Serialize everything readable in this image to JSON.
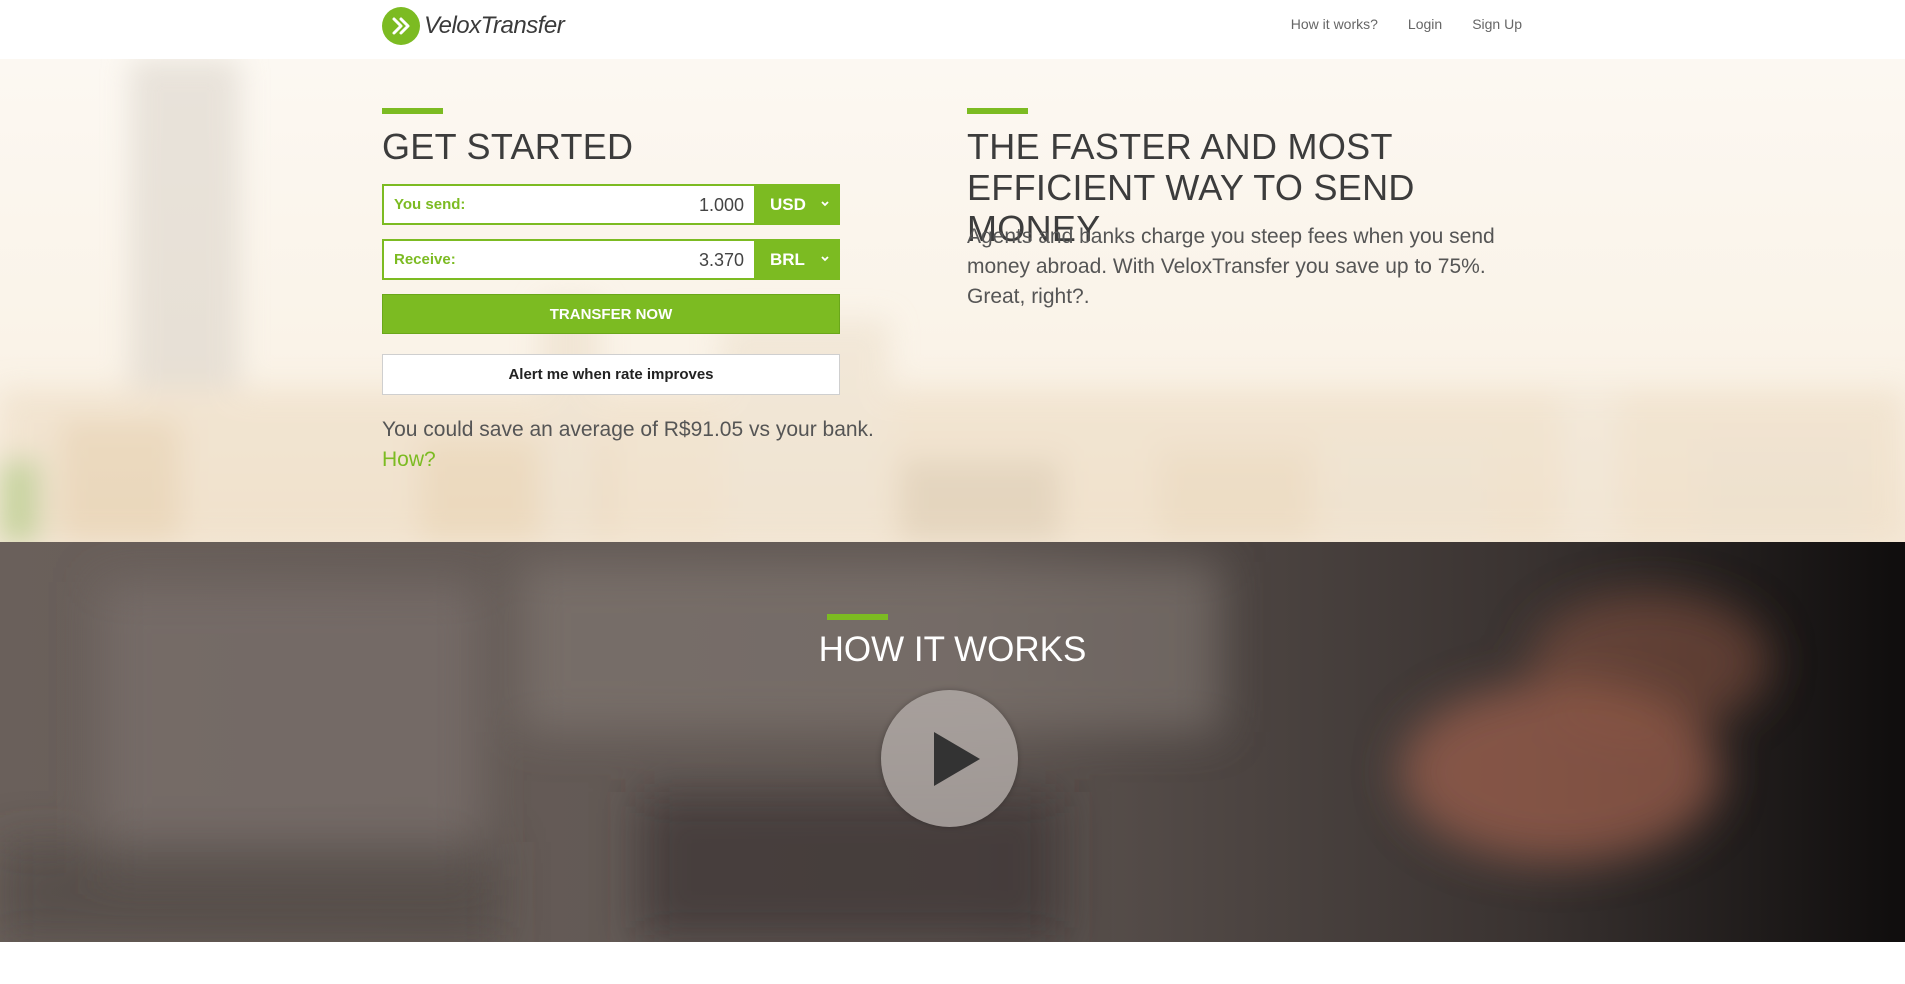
{
  "header": {
    "brand": "VeloxTransfer",
    "nav": {
      "how_it_works": "How it works?",
      "login": "Login",
      "sign_up": "Sign Up"
    }
  },
  "get_started": {
    "title": "GET STARTED",
    "send": {
      "label": "You send:",
      "value": "1.000",
      "currency": "USD"
    },
    "receive": {
      "label": "Receive:",
      "value": "3.370",
      "currency": "BRL"
    },
    "transfer_button": "TRANSFER NOW",
    "alert_button": "Alert me when rate improves",
    "savings_text": "You could save an average of R$91.05 vs your bank.",
    "how_link": "How?"
  },
  "tagline": {
    "title": "THE FASTER AND MOST EFFICIENT WAY TO SEND MONEY",
    "description": "Agents and banks charge you steep fees when you send money abroad. With VeloxTransfer you save up to 75%. Great, right?."
  },
  "how_it_works": {
    "title": "HOW IT WORKS",
    "video_icon": "play-icon"
  },
  "colors": {
    "accent": "#7cbb22",
    "text_dark": "#3c3c3c",
    "how_section_bg": "#5a4f4b"
  }
}
